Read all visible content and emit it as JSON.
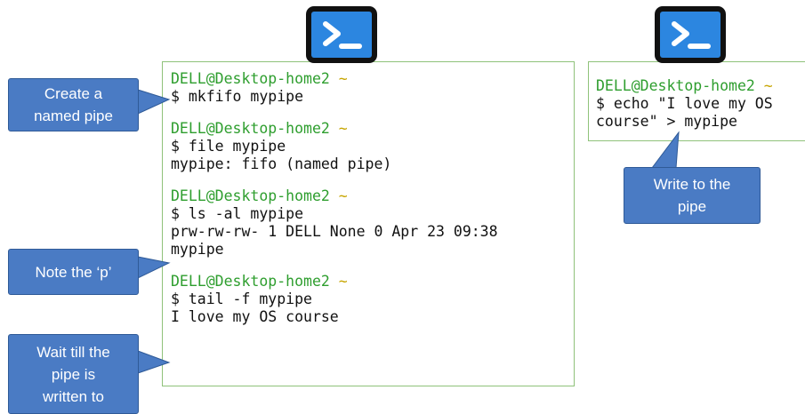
{
  "terminal_left": {
    "blocks": [
      {
        "user": "DELL@Desktop-home2",
        "tilde": "~",
        "lines": [
          "$ mkfifo mypipe"
        ]
      },
      {
        "user": "DELL@Desktop-home2",
        "tilde": "~",
        "lines": [
          "$ file mypipe",
          "mypipe: fifo (named pipe)"
        ]
      },
      {
        "user": "DELL@Desktop-home2",
        "tilde": "~",
        "lines": [
          "$ ls -al mypipe",
          "prw-rw-rw- 1 DELL None 0 Apr 23 09:38",
          "mypipe"
        ]
      },
      {
        "user": "DELL@Desktop-home2",
        "tilde": "~",
        "lines": [
          "$ tail -f mypipe",
          "I love my OS course"
        ]
      }
    ]
  },
  "terminal_right": {
    "user": "DELL@Desktop-home2",
    "tilde": "~",
    "lines": [
      "$ echo \"I love my OS",
      "course\" > mypipe"
    ]
  },
  "callouts": {
    "create": [
      "Create a",
      "named pipe"
    ],
    "note": [
      "Note the ‘p’"
    ],
    "wait": [
      "Wait till the",
      "pipe is",
      "written to"
    ],
    "write": [
      "Write to the",
      "pipe"
    ]
  },
  "icons": {
    "left": "terminal-icon",
    "right": "terminal-icon"
  },
  "colors": {
    "terminal_border": "#8fc27a",
    "prompt_user": "#2e9e2e",
    "prompt_tilde": "#c7a500",
    "callout_fill": "#4a7bc4",
    "icon_blue": "#2c86e0"
  }
}
